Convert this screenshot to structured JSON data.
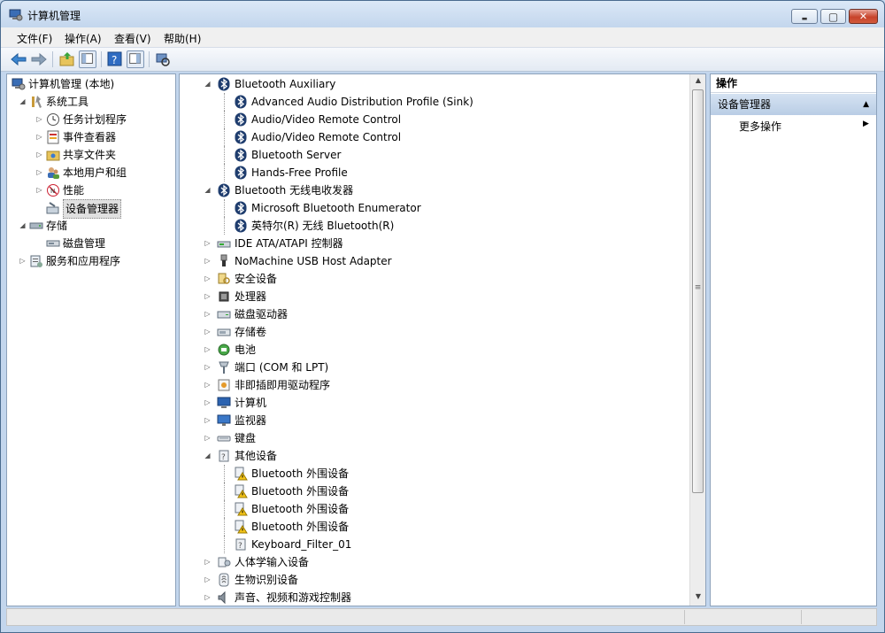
{
  "window": {
    "title": "计算机管理",
    "minimize": "▬",
    "maximize": "▢",
    "close": "✕"
  },
  "menu": [
    "文件(F)",
    "操作(A)",
    "查看(V)",
    "帮助(H)"
  ],
  "tree": [
    {
      "label": "计算机管理 (本地)",
      "toggle": "",
      "icon": "computer-management-icon"
    },
    {
      "label": "系统工具",
      "toggle": "◢",
      "icon": "system-tools-icon"
    },
    {
      "label": "任务计划程序",
      "toggle": "▷",
      "icon": "task-scheduler-icon"
    },
    {
      "label": "事件查看器",
      "toggle": "▷",
      "icon": "event-viewer-icon"
    },
    {
      "label": "共享文件夹",
      "toggle": "▷",
      "icon": "shared-folders-icon"
    },
    {
      "label": "本地用户和组",
      "toggle": "▷",
      "icon": "local-users-icon"
    },
    {
      "label": "性能",
      "toggle": "▷",
      "icon": "performance-icon"
    },
    {
      "label": "设备管理器",
      "toggle": "",
      "icon": "device-manager-icon"
    },
    {
      "label": "存储",
      "toggle": "◢",
      "icon": "storage-icon"
    },
    {
      "label": "磁盘管理",
      "toggle": "",
      "icon": "disk-management-icon"
    },
    {
      "label": "服务和应用程序",
      "toggle": "▷",
      "icon": "services-apps-icon"
    }
  ],
  "devices": [
    {
      "label": "Bluetooth Auxiliary",
      "toggle": "◢",
      "icon": "bluetooth-icon"
    },
    {
      "label": "Advanced Audio Distribution Profile (Sink)",
      "toggle": "",
      "icon": "bluetooth-icon"
    },
    {
      "label": "Audio/Video Remote Control",
      "toggle": "",
      "icon": "bluetooth-icon"
    },
    {
      "label": "Audio/Video Remote Control",
      "toggle": "",
      "icon": "bluetooth-icon"
    },
    {
      "label": "Bluetooth Server",
      "toggle": "",
      "icon": "bluetooth-icon"
    },
    {
      "label": "Hands-Free Profile",
      "toggle": "",
      "icon": "bluetooth-icon"
    },
    {
      "label": "Bluetooth 无线电收发器",
      "toggle": "◢",
      "icon": "bluetooth-icon"
    },
    {
      "label": "Microsoft Bluetooth Enumerator",
      "toggle": "",
      "icon": "bluetooth-icon"
    },
    {
      "label": "英特尔(R) 无线 Bluetooth(R)",
      "toggle": "",
      "icon": "bluetooth-icon"
    },
    {
      "label": "IDE ATA/ATAPI 控制器",
      "toggle": "▷",
      "icon": "ide-controller-icon"
    },
    {
      "label": "NoMachine USB Host Adapter",
      "toggle": "▷",
      "icon": "usb-plug-icon"
    },
    {
      "label": "安全设备",
      "toggle": "▷",
      "icon": "security-key-icon"
    },
    {
      "label": "处理器",
      "toggle": "▷",
      "icon": "processor-icon"
    },
    {
      "label": "磁盘驱动器",
      "toggle": "▷",
      "icon": "disk-drive-icon"
    },
    {
      "label": "存储卷",
      "toggle": "▷",
      "icon": "storage-volume-icon"
    },
    {
      "label": "电池",
      "toggle": "▷",
      "icon": "battery-icon"
    },
    {
      "label": "端口 (COM 和 LPT)",
      "toggle": "▷",
      "icon": "port-icon"
    },
    {
      "label": "非即插即用驱动程序",
      "toggle": "▷",
      "icon": "non-pnp-driver-icon"
    },
    {
      "label": "计算机",
      "toggle": "▷",
      "icon": "computer-icon"
    },
    {
      "label": "监视器",
      "toggle": "▷",
      "icon": "monitor-icon"
    },
    {
      "label": "键盘",
      "toggle": "▷",
      "icon": "keyboard-icon"
    },
    {
      "label": "其他设备",
      "toggle": "◢",
      "icon": "unknown-device-icon"
    },
    {
      "label": "Bluetooth 外围设备",
      "toggle": "",
      "icon": "warning-device-icon"
    },
    {
      "label": "Bluetooth 外围设备",
      "toggle": "",
      "icon": "warning-device-icon"
    },
    {
      "label": "Bluetooth 外围设备",
      "toggle": "",
      "icon": "warning-device-icon"
    },
    {
      "label": "Bluetooth 外围设备",
      "toggle": "",
      "icon": "warning-device-icon"
    },
    {
      "label": "Keyboard_Filter_01",
      "toggle": "",
      "icon": "unknown-device-icon"
    },
    {
      "label": "人体学输入设备",
      "toggle": "▷",
      "icon": "hid-icon"
    },
    {
      "label": "生物识别设备",
      "toggle": "▷",
      "icon": "biometric-icon"
    },
    {
      "label": "声音、视频和游戏控制器",
      "toggle": "▷",
      "icon": "speaker-icon"
    }
  ],
  "actions": {
    "header": "操作",
    "section": "设备管理器",
    "section_arrow": "▲",
    "more": "更多操作",
    "more_arrow": "▶"
  },
  "scroll": {
    "up": "▲",
    "down": "▼",
    "grip": "≡"
  }
}
